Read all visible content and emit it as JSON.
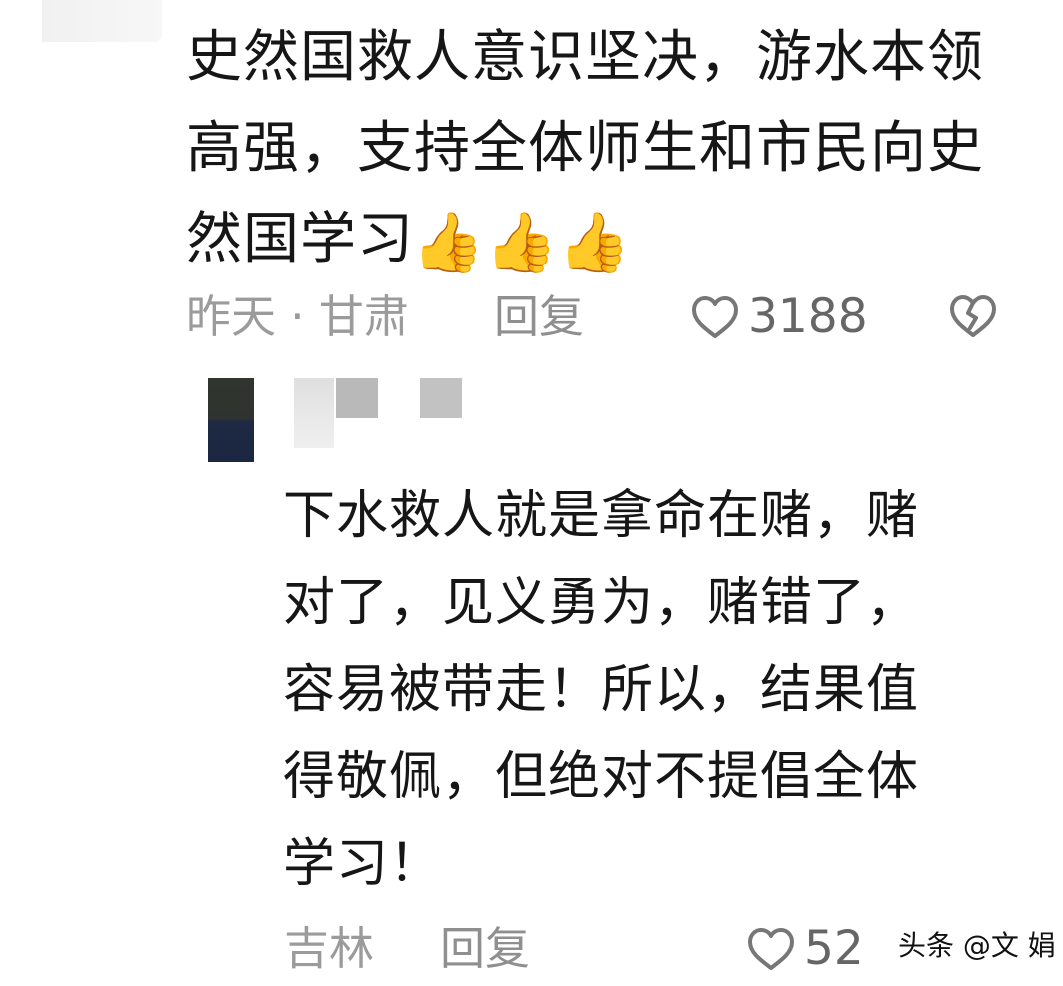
{
  "comments": [
    {
      "text": "史然国救人意识坚决，游水本领\n高强，支持全体师生和市民向史\n然国学习",
      "emoji": "👍👍👍",
      "location": "昨天 · 甘肃",
      "reply_label": "回复",
      "likes": "3188"
    },
    {
      "text": "下水救人就是拿命在赌，赌\n对了，见义勇为，赌错了，\n容易被带走！所以，结果值\n得敬佩，但绝对不提倡全体\n学习！",
      "location": "吉林",
      "reply_label": "回复",
      "likes": "52"
    }
  ],
  "watermark": "头条 @文 娟",
  "icons": {
    "like": "heart-outline-icon",
    "dislike": "broken-heart-outline-icon"
  },
  "colors": {
    "text": "#161616",
    "meta": "#9b9b9b",
    "like_icon": "#777777"
  }
}
